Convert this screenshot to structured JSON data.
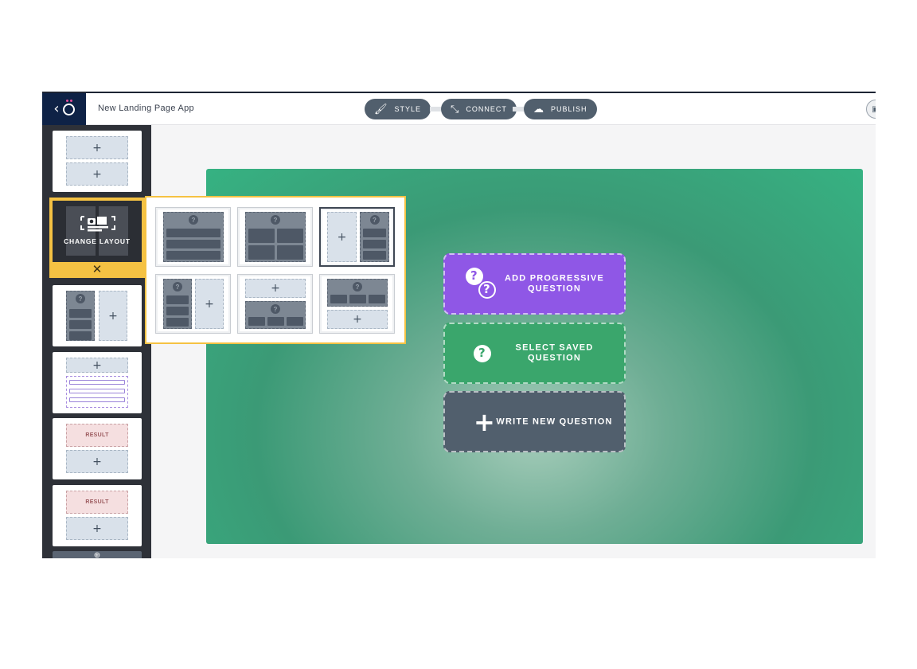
{
  "app": {
    "title": "New Landing Page App",
    "back_icon": "chevron-left-icon",
    "logo_icon": "outgrow-logo-icon"
  },
  "toolbar": {
    "style_label": "STYLE",
    "connect_label": "CONNECT",
    "publish_label": "PUBLISH",
    "style_icon": "brush-icon",
    "connect_icon": "connect-arrows-icon",
    "publish_icon": "cloud-upload-icon",
    "save_icon": "save-icon"
  },
  "sidebar": {
    "change_layout_label": "CHANGE LAYOUT",
    "close_symbol": "✕",
    "plus_symbol": "+",
    "question_symbol": "?",
    "result_label": "RESULT",
    "add_slide_symbol": "⊕"
  },
  "actions": {
    "add_progressive": "ADD PROGRESSIVE QUESTION",
    "select_saved": "SELECT SAVED QUESTION",
    "write_new": "WRITE NEW QUESTION",
    "question_symbol": "?",
    "plus_symbol": "+"
  },
  "colors": {
    "brand_navy": "#0e2246",
    "toolbar_pill": "#515f6d",
    "highlight_yellow": "#f5c243",
    "progressive_purple": "#8f57e6",
    "saved_green": "#3aa66c",
    "write_slate": "#515f6d",
    "canvas_green": "#36a57c"
  }
}
